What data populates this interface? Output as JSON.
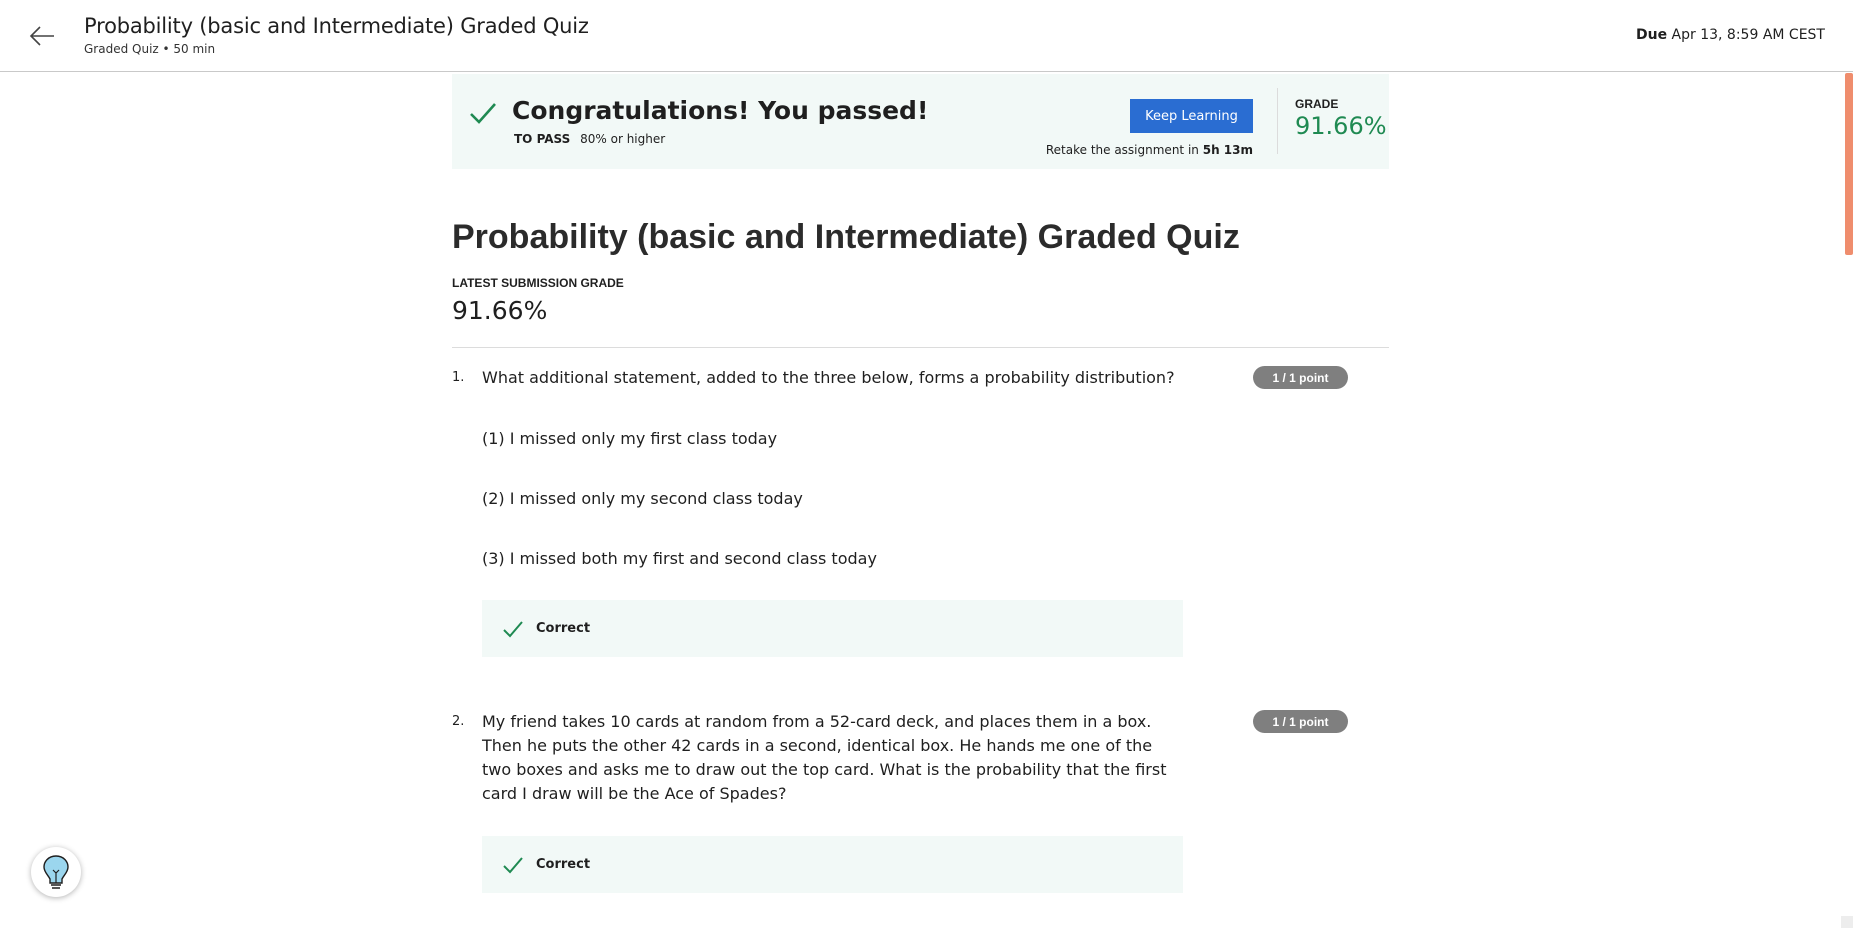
{
  "header": {
    "title": "Probability (basic and Intermediate) Graded Quiz",
    "subtitle": "Graded Quiz • 50 min",
    "due_label": "Due",
    "due_value": "Apr 13, 8:59 AM CEST"
  },
  "banner": {
    "title": "Congratulations! You passed!",
    "to_pass_label": "TO PASS",
    "to_pass_value": "80% or higher",
    "keep_learning_label": "Keep Learning",
    "retake_prefix": "Retake the assignment in",
    "retake_time": "5h 13m",
    "grade_label": "GRADE",
    "grade_value": "91.66%"
  },
  "main": {
    "title": "Probability (basic and Intermediate) Graded Quiz",
    "latest_label": "LATEST SUBMISSION GRADE",
    "latest_value": "91.66%"
  },
  "questions": [
    {
      "number": "1.",
      "text": "What additional statement, added to the three below, forms a probability distribution?",
      "points": "1 / 1 point",
      "options": [
        "(1) I missed only my first class today",
        "(2) I missed only my second class today",
        "(3) I missed both my first and second class today"
      ],
      "result": "Correct"
    },
    {
      "number": "2.",
      "text": "My friend takes 10 cards at random from a 52-card deck, and places them in a box. Then he puts the other 42 cards in a second, identical box. He hands me one of the two boxes and asks me to draw out the top card. What is the probability that the first card I draw will be the Ace of Spades?",
      "points": "1 / 1 point",
      "result": "Correct"
    }
  ],
  "icons": {
    "back": "arrow-left-icon",
    "check": "checkmark-icon",
    "tips": "lightbulb-icon"
  },
  "colors": {
    "accent_blue": "#2a6dd2",
    "success_green": "#1f8a52",
    "banner_bg": "#f2f9f7",
    "points_badge": "#7f7f7f",
    "scroll_thumb": "#ef8d6d"
  }
}
